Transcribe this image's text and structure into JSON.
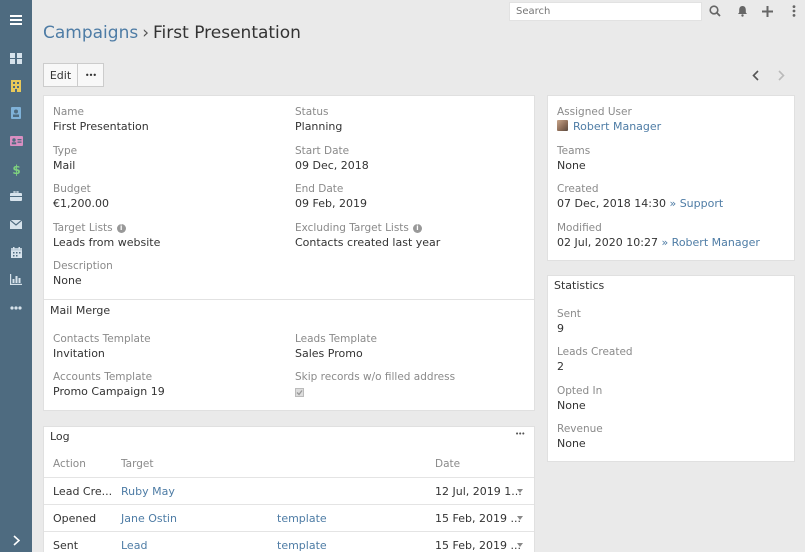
{
  "search": {
    "placeholder": "Search"
  },
  "breadcrumb": {
    "parent": "Campaigns",
    "separator": "›",
    "current": "First Presentation"
  },
  "actions": {
    "edit_label": "Edit",
    "more_label": "•••"
  },
  "overview": {
    "name": {
      "label": "Name",
      "value": "First Presentation"
    },
    "status": {
      "label": "Status",
      "value": "Planning"
    },
    "type": {
      "label": "Type",
      "value": "Mail"
    },
    "start_date": {
      "label": "Start Date",
      "value": "09 Dec, 2018"
    },
    "budget": {
      "label": "Budget",
      "value": "€1,200.00"
    },
    "end_date": {
      "label": "End Date",
      "value": "09 Feb, 2019"
    },
    "target_lists": {
      "label": "Target Lists",
      "value": "Leads from website"
    },
    "excluding_target_lists": {
      "label": "Excluding Target Lists",
      "value": "Contacts created last year"
    },
    "description": {
      "label": "Description",
      "value": "None"
    }
  },
  "mail_merge": {
    "title": "Mail Merge",
    "contacts_template": {
      "label": "Contacts Template",
      "value": "Invitation"
    },
    "leads_template": {
      "label": "Leads Template",
      "value": "Sales Promo"
    },
    "accounts_template": {
      "label": "Accounts Template",
      "value": "Promo Campaign 19"
    },
    "skip_records": {
      "label": "Skip records w/o filled address",
      "checked": true
    }
  },
  "log": {
    "title": "Log",
    "menu_label": "•••",
    "columns": {
      "action": "Action",
      "target": "Target",
      "date": "Date"
    },
    "rows": [
      {
        "action": "Lead Cre...",
        "target": "Ruby May",
        "extra": "",
        "date": "12 Jul, 2019 1..."
      },
      {
        "action": "Opened",
        "target": "Jane Ostin",
        "extra": "template",
        "date": "15 Feb, 2019 ..."
      },
      {
        "action": "Sent",
        "target": "Lead",
        "extra": "template",
        "date": "15 Feb, 2019 ..."
      }
    ]
  },
  "side": {
    "assigned_user": {
      "label": "Assigned User",
      "value": "Robert Manager"
    },
    "teams": {
      "label": "Teams",
      "value": "None"
    },
    "created": {
      "label": "Created",
      "value": "07 Dec, 2018 14:30",
      "by": "» Support"
    },
    "modified": {
      "label": "Modified",
      "value": "02 Jul, 2020 10:27",
      "by": "» Robert Manager"
    }
  },
  "statistics": {
    "title": "Statistics",
    "sent": {
      "label": "Sent",
      "value": "9"
    },
    "leads_created": {
      "label": "Leads Created",
      "value": "2"
    },
    "opted_in": {
      "label": "Opted In",
      "value": "None"
    },
    "revenue": {
      "label": "Revenue",
      "value": "None"
    }
  },
  "sidebar_icons": [
    {
      "name": "menu-icon",
      "color": "#ffffff"
    },
    {
      "name": "dashboard-icon",
      "color": "#d7e3ec"
    },
    {
      "name": "accounts-icon",
      "color": "#e8c95a"
    },
    {
      "name": "contacts-icon",
      "color": "#7fb2d9"
    },
    {
      "name": "leads-icon",
      "color": "#d98fc2"
    },
    {
      "name": "opportunities-icon",
      "color": "#7fd17f"
    },
    {
      "name": "cases-icon",
      "color": "#d7e3ec"
    },
    {
      "name": "email-icon",
      "color": "#d7e3ec"
    },
    {
      "name": "calendar-icon",
      "color": "#d7e3ec"
    },
    {
      "name": "reports-icon",
      "color": "#d7e3ec"
    },
    {
      "name": "more-icon",
      "color": "#d7e3ec"
    },
    {
      "name": "collapse-icon",
      "color": "#ffffff"
    }
  ],
  "colors": {
    "sidebar": "#4e6b80",
    "link": "#4e7ca5",
    "background": "#eaeaea"
  }
}
